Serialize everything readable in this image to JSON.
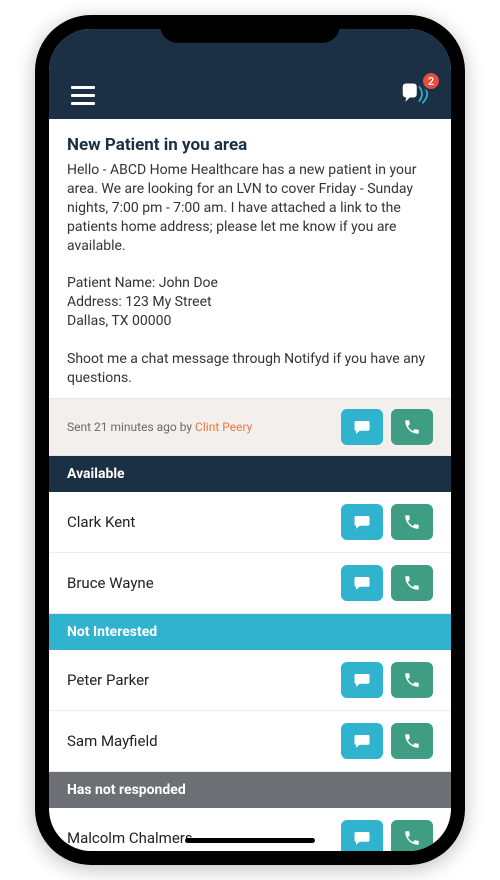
{
  "header": {
    "notification_count": "2"
  },
  "message": {
    "title": "New Patient in you area",
    "body": "Hello - ABCD Home Healthcare has a new patient in your area. We are looking for an LVN to cover Friday - Sunday nights, 7:00 pm - 7:00 am. I have attached a link to the patients home address; please let me know if you are available.\n\nPatient Name: John Doe\nAddress: 123 My Street\n                  Dallas, TX 00000\n\nShoot me a chat message through Notifyd if you have any questions.",
    "sent_prefix": "Sent 21 minutes ago by ",
    "sender": "Clint Peery"
  },
  "sections": {
    "available": {
      "label": "Available",
      "people": [
        {
          "name": "Clark Kent"
        },
        {
          "name": "Bruce Wayne"
        }
      ]
    },
    "not_interested": {
      "label": "Not Interested",
      "people": [
        {
          "name": "Peter Parker"
        },
        {
          "name": "Sam Mayfield"
        }
      ]
    },
    "no_response": {
      "label": "Has not responded",
      "people": [
        {
          "name": "Malcolm Chalmers"
        }
      ]
    }
  },
  "icons": {
    "chat": "chat-icon",
    "call": "phone-icon",
    "menu": "hamburger-icon",
    "notify": "speech-wave-icon"
  }
}
